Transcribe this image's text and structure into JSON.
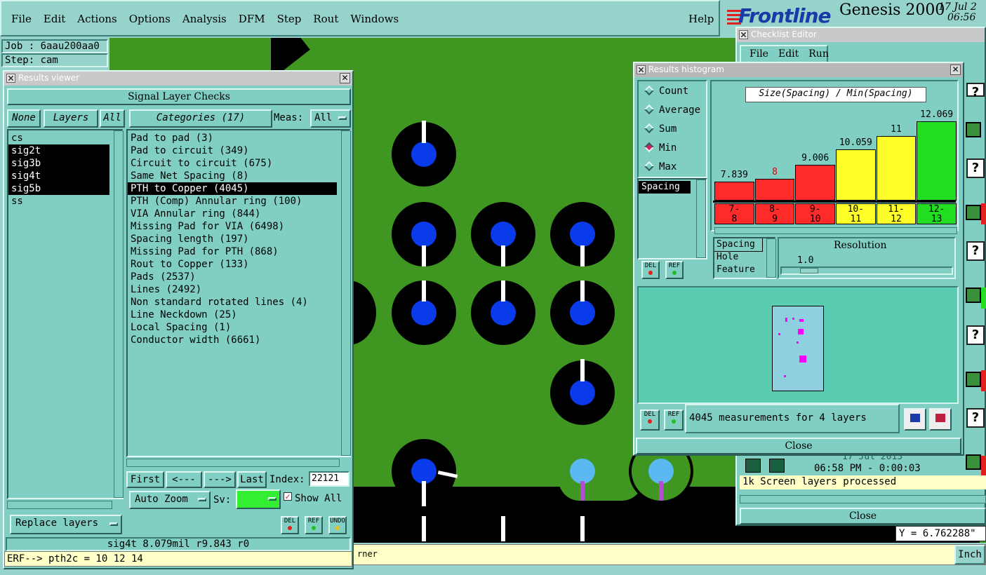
{
  "menubar": {
    "items": [
      "File",
      "Edit",
      "Actions",
      "Options",
      "Analysis",
      "DFM",
      "Step",
      "Rout",
      "Windows"
    ],
    "help": "Help"
  },
  "brand": {
    "logo": "Frontline",
    "product": "Genesis 2000",
    "date": "17 Jul 2",
    "time": "06:56"
  },
  "job": {
    "job_line": "Job : 6aau200aa0",
    "step_line": "Step: cam"
  },
  "results_viewer": {
    "title": "Results viewer",
    "header": "Signal Layer Checks",
    "none_btn": "None",
    "layers_btn": "Layers",
    "all_btn": "All",
    "categories_btn": "Categories (17)",
    "meas_label": "Meas:",
    "meas_value": "All",
    "layers": [
      {
        "name": "cs",
        "selected": false
      },
      {
        "name": "sig2t",
        "selected": true
      },
      {
        "name": "sig3b",
        "selected": true
      },
      {
        "name": "sig4t",
        "selected": true
      },
      {
        "name": "sig5b",
        "selected": true
      },
      {
        "name": "ss",
        "selected": false
      }
    ],
    "categories": [
      {
        "name": "Pad to pad (3)",
        "selected": false
      },
      {
        "name": "Pad to circuit (349)",
        "selected": false
      },
      {
        "name": "Circuit to circuit (675)",
        "selected": false
      },
      {
        "name": "Same Net Spacing (8)",
        "selected": false
      },
      {
        "name": "PTH to Copper (4045)",
        "selected": true
      },
      {
        "name": "PTH (Comp) Annular ring (100)",
        "selected": false
      },
      {
        "name": "VIA Annular ring (844)",
        "selected": false
      },
      {
        "name": "Missing Pad for VIA (6498)",
        "selected": false
      },
      {
        "name": "Spacing length (197)",
        "selected": false
      },
      {
        "name": "Missing Pad for PTH (868)",
        "selected": false
      },
      {
        "name": "Rout to Copper (133)",
        "selected": false
      },
      {
        "name": "Pads (2537)",
        "selected": false
      },
      {
        "name": "Lines (2492)",
        "selected": false
      },
      {
        "name": "Non standard rotated lines (4)",
        "selected": false
      },
      {
        "name": "Line Neckdown (25)",
        "selected": false
      },
      {
        "name": "Local Spacing (1)",
        "selected": false
      },
      {
        "name": "Conductor width (6661)",
        "selected": false
      }
    ],
    "first_btn": "First",
    "prev_btn": "<---",
    "next_btn": "--->",
    "last_btn": "Last",
    "index_label": "Index:",
    "index_value": "22121",
    "auto_zoom": "Auto Zoom",
    "sv_label": "Sv:",
    "show_all": "Show All",
    "replace_layers": "Replace layers",
    "del_btn": "DEL",
    "ref_btn": "REF",
    "undo_btn": "UNDO",
    "status": "sig4t 8.079mil  r9.843  r0",
    "erf": "ERF--> pth2c = 10 12 14"
  },
  "histogram": {
    "title": "Results histogram",
    "modes": [
      {
        "label": "Count",
        "on": false
      },
      {
        "label": "Average",
        "on": false
      },
      {
        "label": "Sum",
        "on": false
      },
      {
        "label": "Min",
        "on": true
      },
      {
        "label": "Max",
        "on": false
      }
    ],
    "list_item": "Spacing",
    "heading": "Size(Spacing) / Min(Spacing)",
    "bars": [
      {
        "value": "7.839",
        "range": "7-\n8",
        "color": "#ff2a2a",
        "text": "#000"
      },
      {
        "value": "8",
        "range": "8-\n9",
        "color": "#ff2a2a",
        "text": "#e00000"
      },
      {
        "value": "9.006",
        "range": "9-\n10",
        "color": "#ff2a2a",
        "text": "#000"
      },
      {
        "value": "10.059",
        "range": "10-\n11",
        "color": "#ffff2a",
        "text": "#000"
      },
      {
        "value": "11",
        "range": "11-\n12",
        "color": "#ffff2a",
        "text": "#000"
      },
      {
        "value": "12.069",
        "range": "12-\n13",
        "color": "#22dd22",
        "text": "#000"
      }
    ],
    "type_list": [
      "Spacing",
      "Hole",
      "Feature"
    ],
    "resolution_label": "Resolution",
    "resolution_value": "1.0",
    "del_btn": "DEL",
    "ref_btn": "REF",
    "measurements": "4045 measurements for 4 layers",
    "close": "Close"
  },
  "checklist": {
    "title": "Checklist Editor",
    "menu": [
      "File",
      "Edit",
      "Run"
    ],
    "time_row": "17 Jul 2013",
    "time_row2": "06:58 PM - 0:00:03",
    "processed": "1k Screen layers processed",
    "close": "Close",
    "y_readout": "Y = 6.762288\""
  },
  "bottom": {
    "corner_text": "rner",
    "inch": "Inch"
  },
  "chart_data": {
    "type": "bar",
    "title": "Size(Spacing) / Min(Spacing)",
    "categories": [
      "7-8",
      "8-9",
      "9-10",
      "10-11",
      "11-12",
      "12-13"
    ],
    "values": [
      7.839,
      8,
      9.006,
      10.059,
      11,
      12.069
    ],
    "colors": [
      "#ff2a2a",
      "#ff2a2a",
      "#ff2a2a",
      "#ffff2a",
      "#ffff2a",
      "#22dd22"
    ],
    "xlabel": "",
    "ylabel": ""
  }
}
